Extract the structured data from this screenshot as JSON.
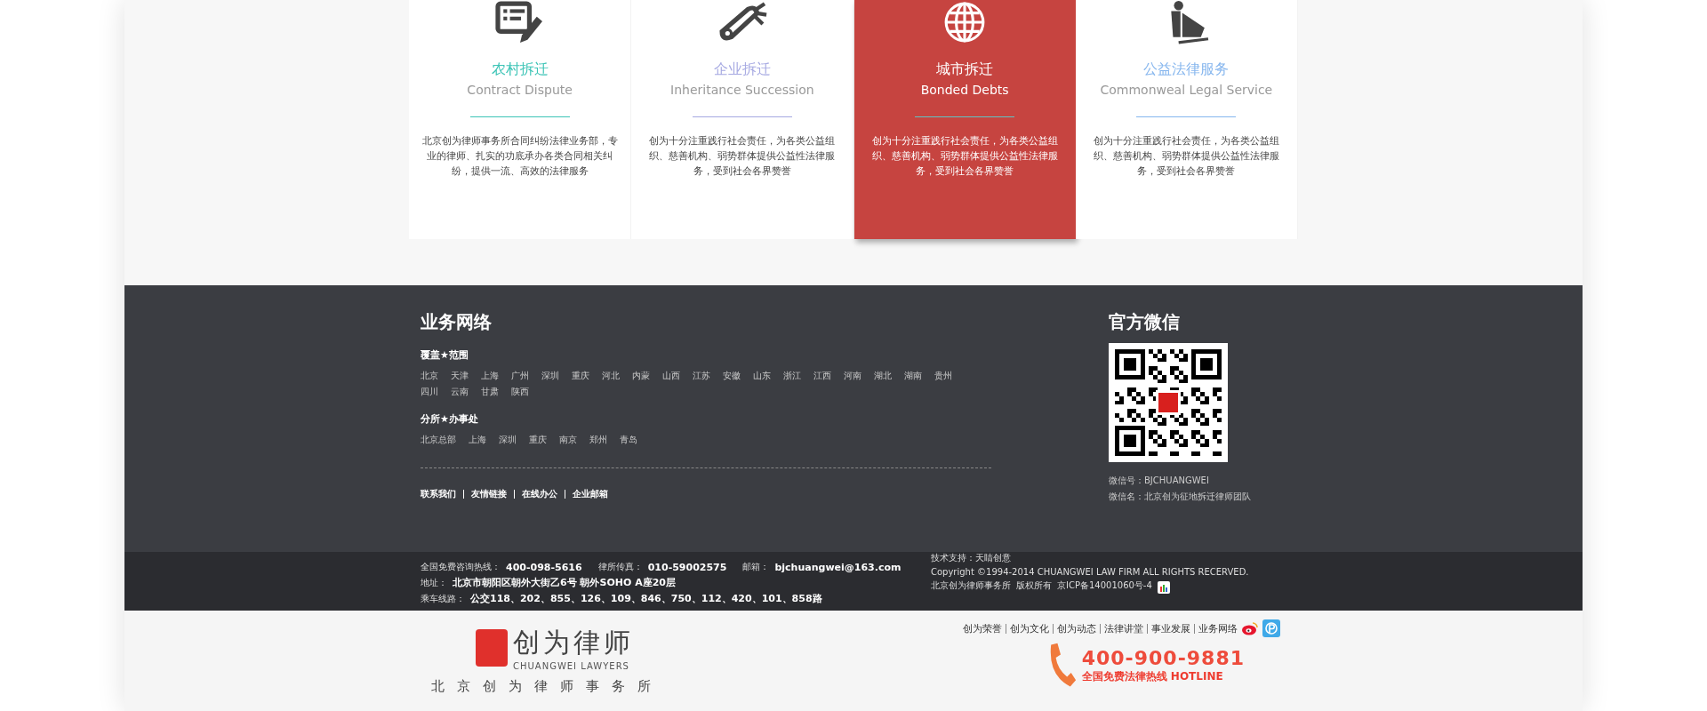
{
  "services": [
    {
      "title": "农村拆迁",
      "subtitle": "Contract Dispute",
      "description": "北京创为律师事务所合同纠纷法律业务部，专业的律师、扎实的功底承办各类合同相关纠纷，提供一流、高效的法律服务",
      "color": "#3cc4b6",
      "selected": false
    },
    {
      "title": "企业拆迁",
      "subtitle": "Inheritance Succession",
      "description": "创为十分注重践行社会责任，为各类公益组织、慈善机构、弱势群体提供公益性法律服务，受到社会各界赞誉",
      "color": "#a6a9e2",
      "selected": false
    },
    {
      "title": "城市拆迁",
      "subtitle": "Bonded Debts",
      "description": "创为十分注重践行社会责任，为各类公益组织、慈善机构、弱势群体提供公益性法律服务，受到社会各界赞誉",
      "color": "#5fc4c4",
      "selected": true
    },
    {
      "title": "公益法律服务",
      "subtitle": "Commonweal Legal Service",
      "description": "创为十分注重践行社会责任，为各类公益组织、慈善机构、弱势群体提供公益性法律服务，受到社会各界赞誉",
      "color": "#86b6ee",
      "selected": false
    }
  ],
  "network": {
    "title": "业务网络",
    "coverage": {
      "heading": "覆盖★范围",
      "places": [
        "北京",
        "天津",
        "上海",
        "广州",
        "深圳",
        "重庆",
        "河北",
        "内蒙",
        "山西",
        "江苏",
        "安徽",
        "山东",
        "浙江",
        "江西",
        "河南",
        "湖北",
        "湖南",
        "贵州",
        "四川",
        "云南",
        "甘肃",
        "陕西"
      ]
    },
    "branches": {
      "heading": "分所★办事处",
      "places": [
        "北京总部",
        "上海",
        "深圳",
        "重庆",
        "南京",
        "郑州",
        "青岛"
      ]
    },
    "links": [
      "联系我们",
      "友情链接",
      "在线办公",
      "企业邮箱"
    ]
  },
  "wechat": {
    "title": "官方微信",
    "account": "微信号：BJCHUANGWEI",
    "name": "微信名：北京创为征地拆迁律师团队"
  },
  "contact": [
    [
      {
        "label": "全国免费咨询热线：",
        "value": "400-098-5616"
      },
      {
        "label": "律所传真：",
        "value": "010-59002575"
      },
      {
        "label": "邮箱：",
        "value": "bjchuangwei@163.com"
      }
    ],
    [
      {
        "label": "地址：",
        "value": "北京市朝阳区朝外大街乙6号 朝外SOHO A座20层"
      }
    ],
    [
      {
        "label": "乘车线路：",
        "value": "公交118、202、855、126、109、846、750、112、420、101、858路"
      }
    ]
  ],
  "credits": {
    "support": "技术支持：天睛创意",
    "copyright": "Copyright ©1994-2014 CHUANGWEI LAW FIRM ALL RIGHTS RECERVED.",
    "owner": "北京创为律师事务所",
    "rights": "版权所有",
    "icp": "京ICP备14001060号-4"
  },
  "header": {
    "logo_text": "创为律师",
    "logo_english": "CHUANGWEI LAWYERS",
    "firm_name": "北京创为律师事务所",
    "nav": [
      "创为荣誉",
      "创为文化",
      "创为动态",
      "法律讲堂",
      "事业发展",
      "业务网络"
    ],
    "phone": "400-900-9881",
    "hotline": "全国免费法律热线 HOTLINE"
  }
}
